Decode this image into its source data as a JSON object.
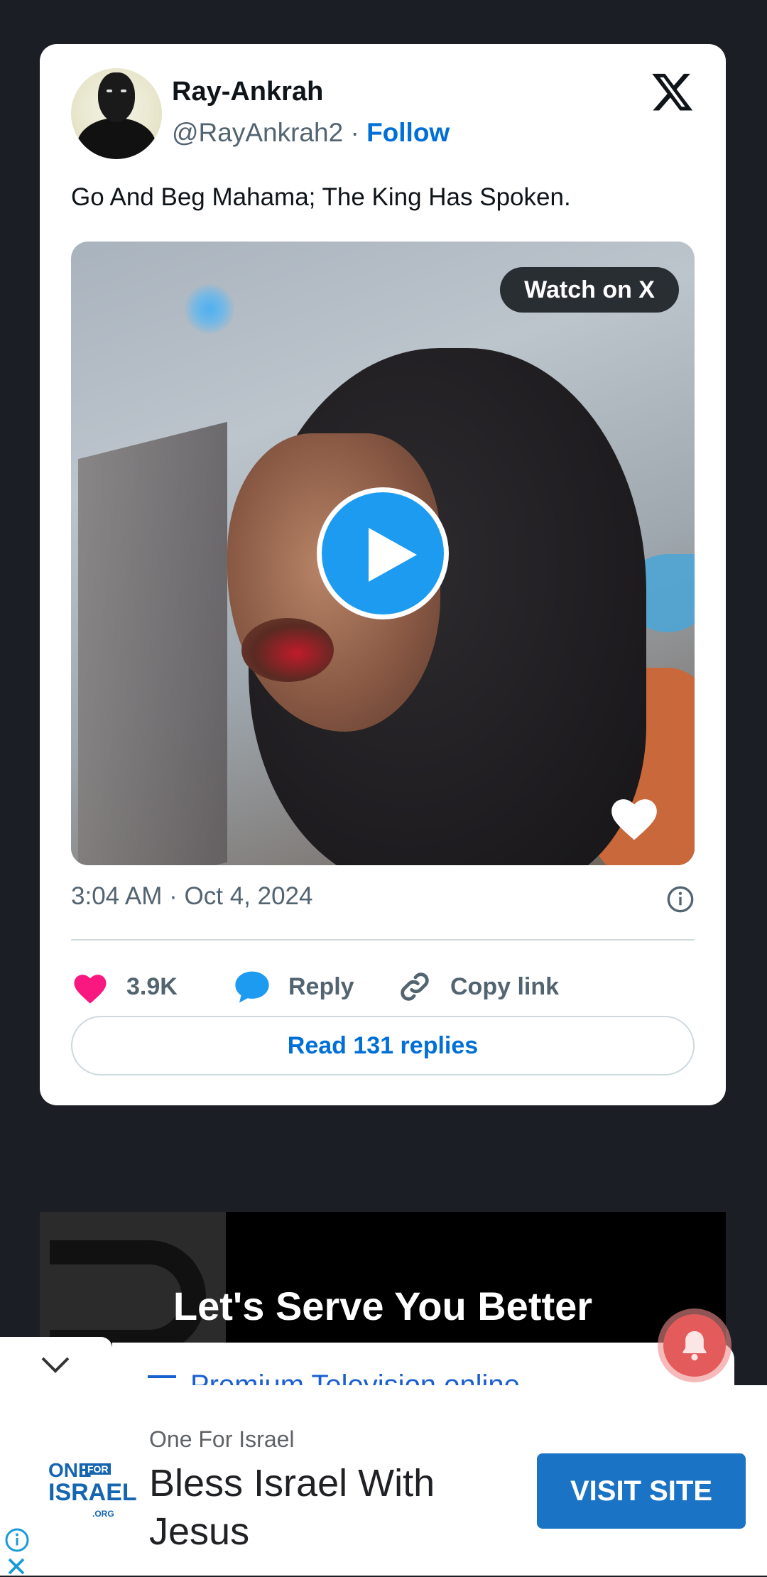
{
  "tweet": {
    "author_name": "Ray-Ankrah",
    "handle": "@RayAnkrah2",
    "separator": "·",
    "follow_label": "Follow",
    "text": "Go And Beg Mahama; The King Has Spoken.",
    "watch_label": "Watch on X",
    "timestamp": "3:04 AM · Oct 4, 2024",
    "likes": "3.9K",
    "reply_label": "Reply",
    "copy_link_label": "Copy link",
    "read_replies_label": "Read 131 replies"
  },
  "banner": {
    "title": "Let's Serve You Better",
    "peek_text": "Premium Television online"
  },
  "ad": {
    "logo_line1": "ONE",
    "logo_for": "FOR",
    "logo_line2": "ISRAEL",
    "logo_org": ".ORG",
    "brand": "One For Israel",
    "headline": "Bless Israel With Jesus",
    "cta": "VISIT SITE"
  },
  "colors": {
    "page_bg": "#1b1f25",
    "link_blue": "#006fd6",
    "like_pink": "#f91880",
    "reply_blue": "#1d9bf0",
    "cta_blue": "#1a73c4"
  },
  "icons": [
    "x-logo-icon",
    "play-icon",
    "heart-icon",
    "info-icon",
    "speech-bubble-icon",
    "link-icon",
    "bell-icon",
    "chevron-down-icon",
    "close-icon"
  ]
}
